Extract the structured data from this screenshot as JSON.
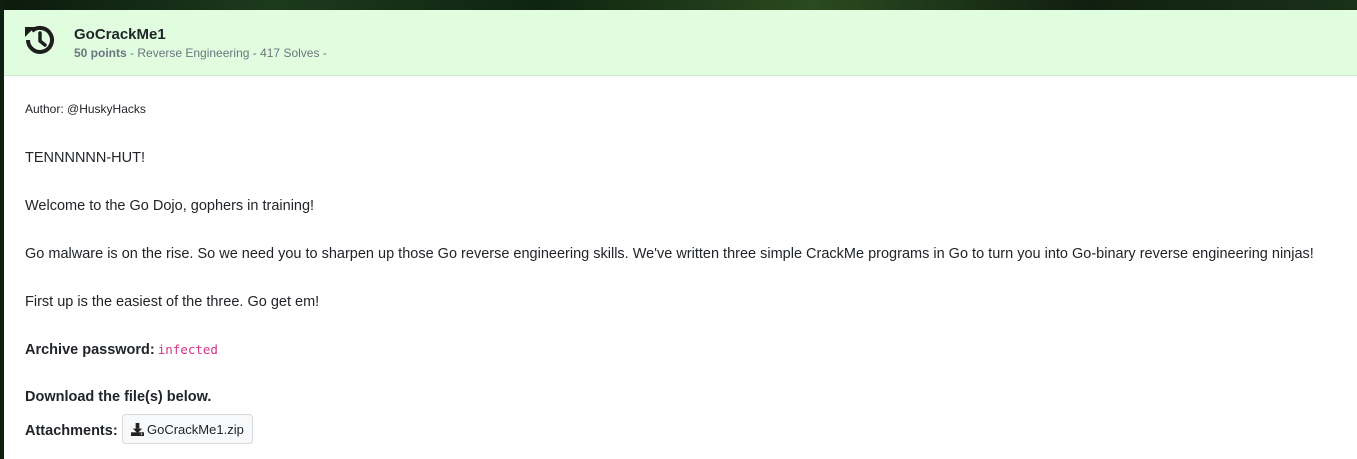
{
  "challenge": {
    "title": "GoCrackMe1",
    "points": "50 points",
    "meta_rest": " - Reverse Engineering - 417 Solves -"
  },
  "description": {
    "author": "Author: @HuskyHacks",
    "line1": "TENNNNNN-HUT!",
    "line2": "Welcome to the Go Dojo, gophers in training!",
    "line3": "Go malware is on the rise. So we need you to sharpen up those Go reverse engineering skills. We've written three simple CrackMe programs in Go to turn you into Go-binary reverse engineering ninjas!",
    "line4": "First up is the easiest of the three. Go get em!",
    "password_label": "Archive password:",
    "password_value": "infected",
    "download_text": "Download the file(s) below.",
    "attachments_label": "Attachments:",
    "attachment_file": "GoCrackMe1.zip"
  },
  "icons": {
    "header_icon": "history-icon",
    "attachment_icon": "download-icon"
  },
  "colors": {
    "header_bg": "#e1fde0",
    "password_code": "#d63384"
  }
}
